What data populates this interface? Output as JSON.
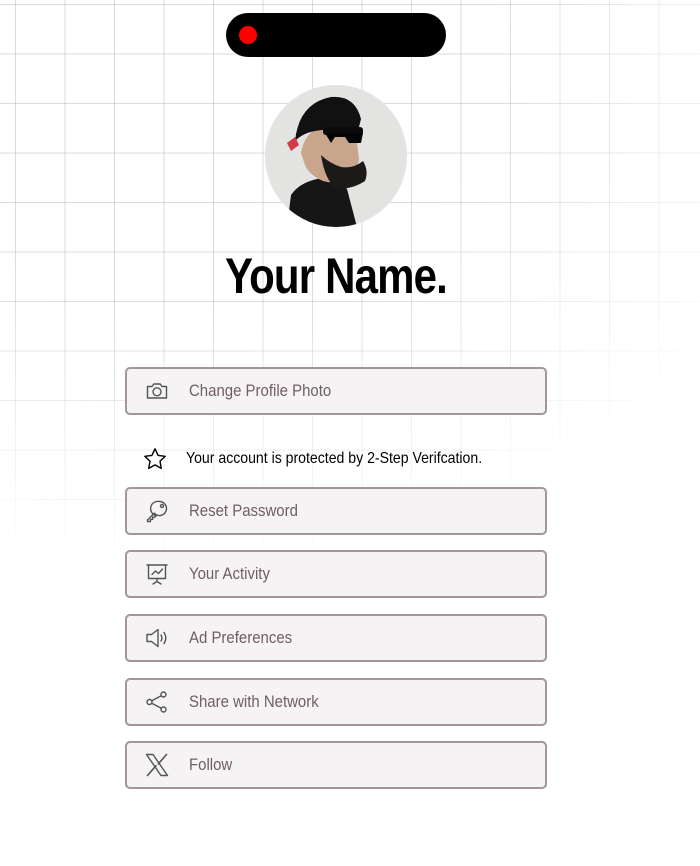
{
  "status_pill": {
    "record_color": "#ff0000"
  },
  "profile": {
    "avatar_icon": "profile-photo",
    "name": "Your Name."
  },
  "actions": [
    {
      "icon": "camera-icon",
      "label": "Change Profile Photo"
    },
    {
      "icon": "key-icon",
      "label": "Reset Password"
    },
    {
      "icon": "activity-chart-icon",
      "label": "Your Activity"
    },
    {
      "icon": "speaker-icon",
      "label": "Ad Preferences"
    },
    {
      "icon": "share-icon",
      "label": "Share with Network"
    },
    {
      "icon": "x-logo-icon",
      "label": "Follow"
    }
  ],
  "security_notice": {
    "icon": "star-icon",
    "text": "Your account is protected by 2-Step Verifcation."
  },
  "colors": {
    "button_border": "#a2969a",
    "button_bg": "#f5f3f4",
    "button_text": "#6f5f62",
    "pill": "#000000"
  }
}
